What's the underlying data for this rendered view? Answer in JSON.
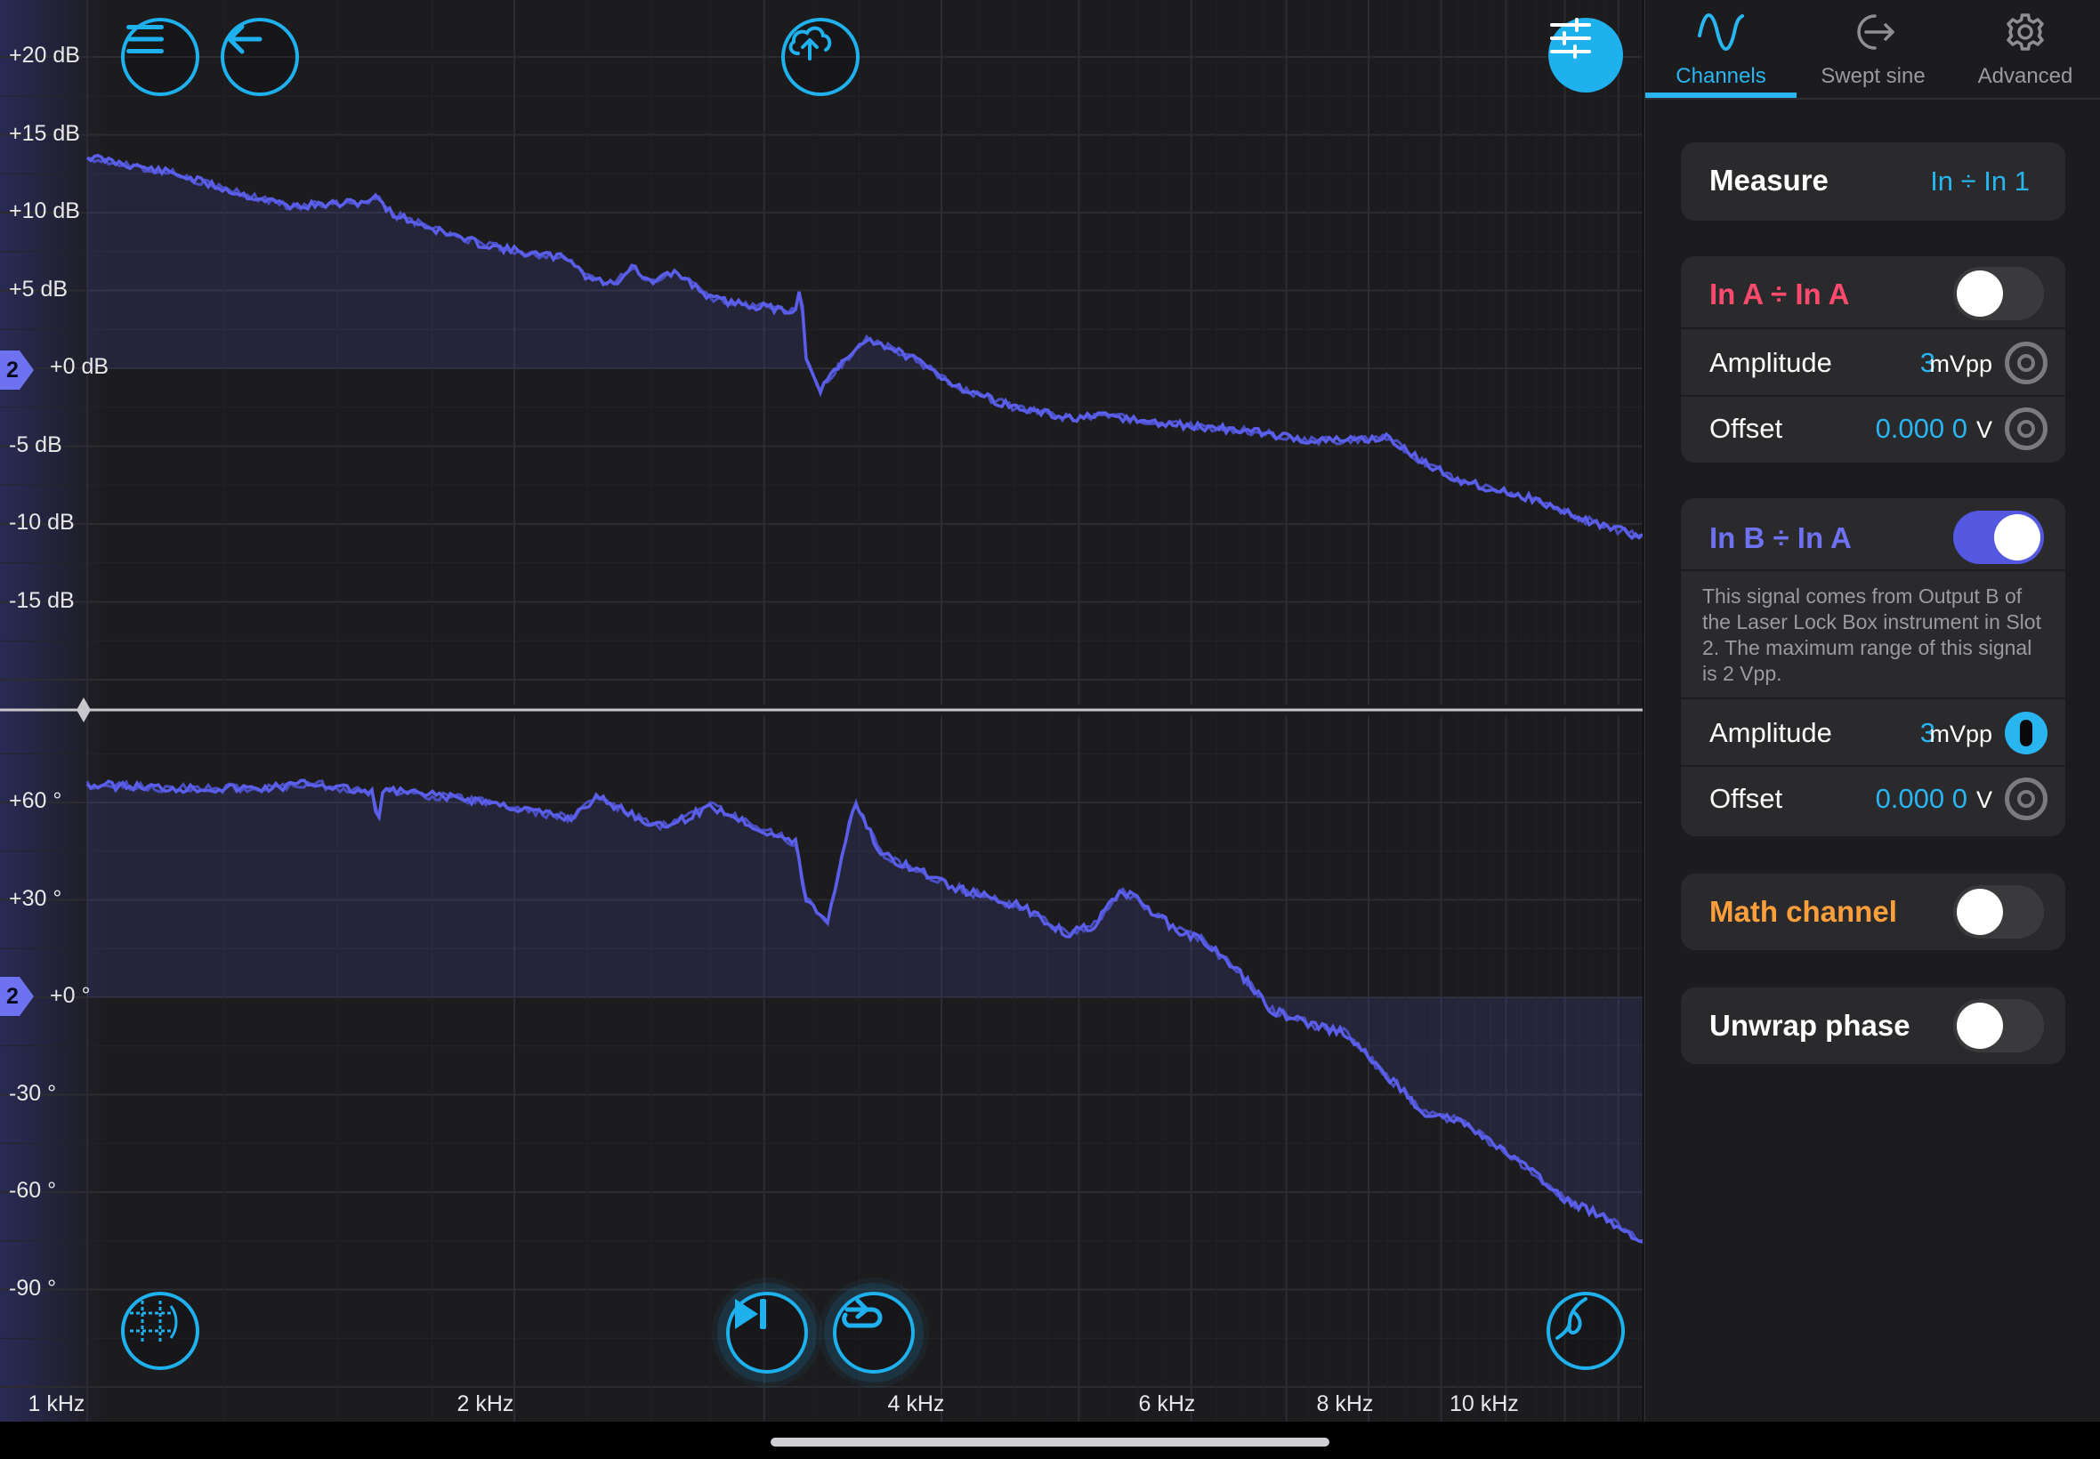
{
  "magnitude_axis": {
    "labels": [
      "+20 dB",
      "+15 dB",
      "+10 dB",
      "+5 dB",
      "+0 dB",
      "-5 dB",
      "-10 dB",
      "-15 dB"
    ],
    "marker": "2"
  },
  "phase_axis": {
    "labels": [
      "+60 °",
      "+30 °",
      "+0 °",
      "-30 °",
      "-60 °",
      "-90 °"
    ],
    "marker": "2"
  },
  "frequency_axis": {
    "labels": [
      "1 kHz",
      "2 kHz",
      "4 kHz",
      "6 kHz",
      "8 kHz",
      "10 kHz"
    ]
  },
  "colors": {
    "trace": "#5a5ee8",
    "accent": "#29b5f0",
    "in_a_title": "#ff4a6e",
    "in_b_title": "#6f72f0",
    "math_title": "#ff9f3c"
  },
  "toolbar": {
    "menu_icon": "hamburger-menu-icon",
    "back_icon": "arrow-left-icon",
    "upload_icon": "cloud-upload-icon",
    "settings_icon": "sliders-icon",
    "grid_icon": "crosshair-grid-icon",
    "step_icon": "skip-forward-icon",
    "repeat_icon": "repeat-icon",
    "probe_icon": "probe-icon"
  },
  "tabs": [
    {
      "label": "Channels",
      "icon": "sine-wave-icon",
      "active": true
    },
    {
      "label": "Swept sine",
      "icon": "swept-sine-icon",
      "active": false
    },
    {
      "label": "Advanced",
      "icon": "gear-icon",
      "active": false
    }
  ],
  "measure": {
    "label": "Measure",
    "value": "In ÷ In 1"
  },
  "in_a": {
    "title": "In A ÷ In A",
    "enabled": false,
    "amplitude": {
      "label": "Amplitude",
      "value": "3",
      "unit": "mVpp"
    },
    "offset": {
      "label": "Offset",
      "value": "0.000 0",
      "unit": "V"
    }
  },
  "in_b": {
    "title": "In B ÷ In A",
    "enabled": true,
    "description": "This signal comes from Output B of the Laser Lock Box instrument in Slot 2. The maximum range of this signal is 2 Vpp.",
    "amplitude": {
      "label": "Amplitude",
      "value": "3",
      "unit": "mVpp"
    },
    "offset": {
      "label": "Offset",
      "value": "0.000 0",
      "unit": "V"
    }
  },
  "math_channel": {
    "title": "Math channel",
    "enabled": false
  },
  "unwrap_phase": {
    "title": "Unwrap phase",
    "enabled": false
  }
}
